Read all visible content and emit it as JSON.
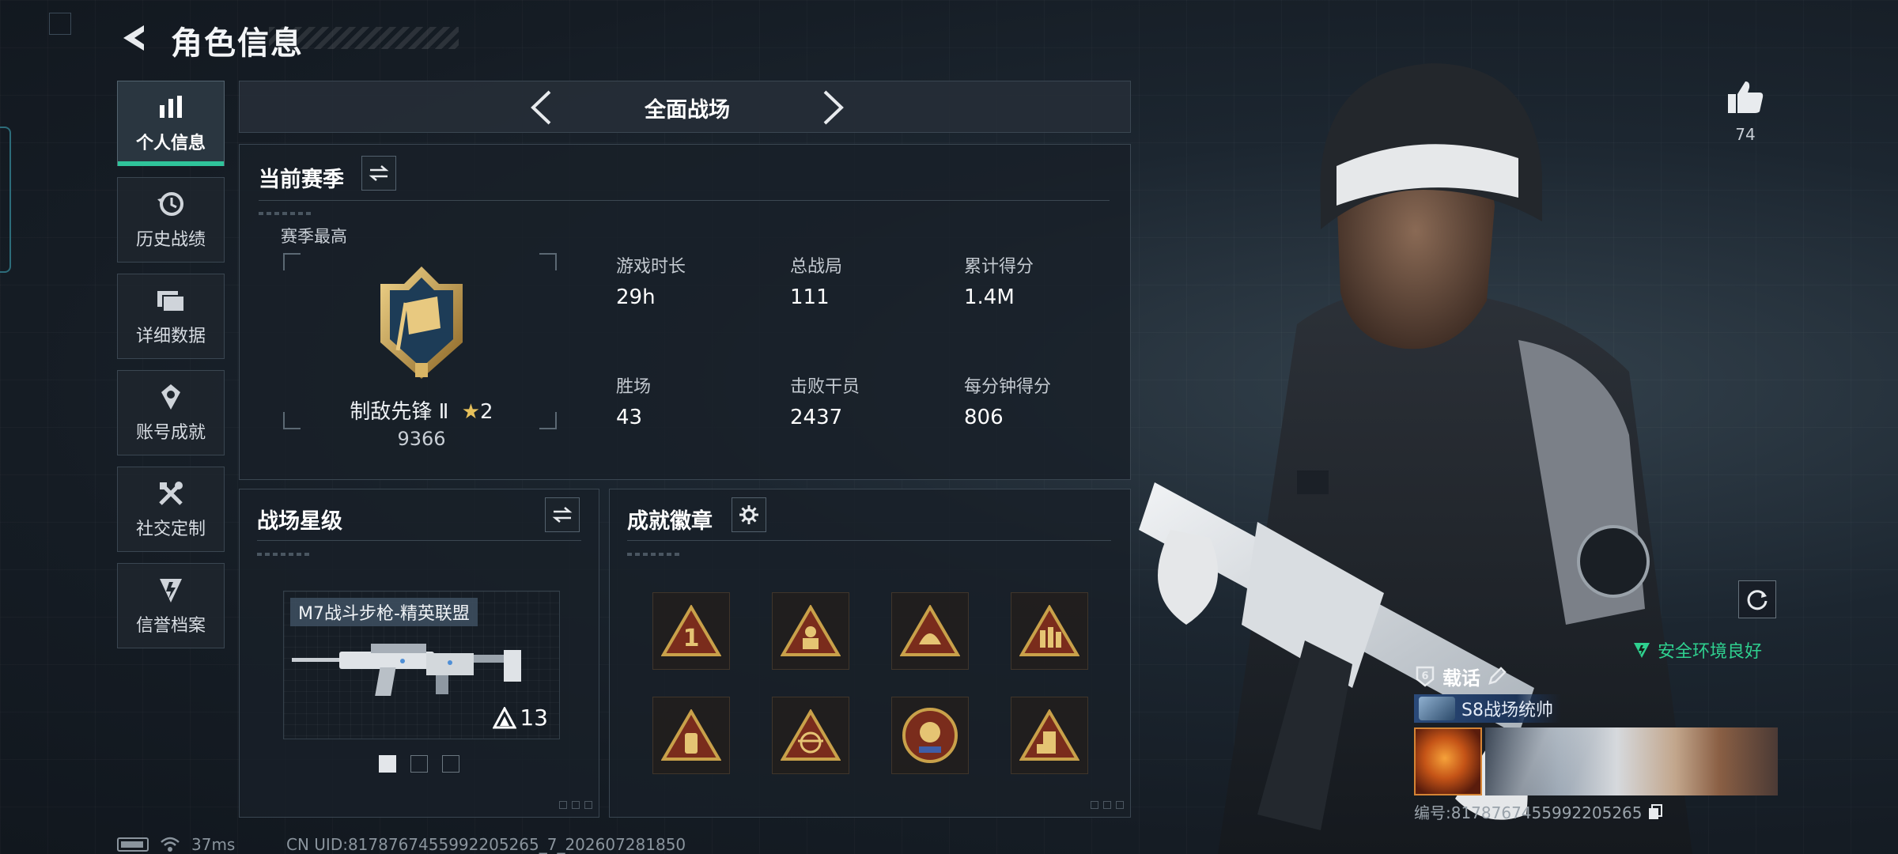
{
  "header": {
    "title": "角色信息"
  },
  "nav": {
    "items": [
      {
        "label": "个人信息",
        "icon": "bar-chart-icon",
        "active": true
      },
      {
        "label": "历史战绩",
        "icon": "history-icon"
      },
      {
        "label": "详细数据",
        "icon": "folder-icon"
      },
      {
        "label": "账号成就",
        "icon": "medal-icon"
      },
      {
        "label": "社交定制",
        "icon": "tools-icon"
      },
      {
        "label": "信誉档案",
        "icon": "shield-icon"
      }
    ]
  },
  "mode": {
    "label": "全面战场"
  },
  "season": {
    "title": "当前赛季",
    "best_label": "赛季最高",
    "rank_name": "制敌先锋 Ⅱ",
    "rank_stars": "2",
    "rank_points": "9366",
    "stats": [
      {
        "label": "游戏时长",
        "value": "29h"
      },
      {
        "label": "总战局",
        "value": "111"
      },
      {
        "label": "累计得分",
        "value": "1.4M"
      },
      {
        "label": "胜场",
        "value": "43"
      },
      {
        "label": "击败干员",
        "value": "2437"
      },
      {
        "label": "每分钟得分",
        "value": "806"
      }
    ]
  },
  "battlefield_star": {
    "title": "战场星级",
    "weapon_name": "M7战斗步枪-精英联盟",
    "weapon_level": "13",
    "page_count": 3,
    "page_active": 1
  },
  "achievements": {
    "title": "成就徽章",
    "badges": [
      "rank-one-badge-icon",
      "soldier-badge-icon",
      "helmet-badge-icon",
      "ammo-badge-icon",
      "grenade-badge-icon",
      "eagle-badge-icon",
      "round-crest-badge-icon",
      "gear-badge-icon"
    ]
  },
  "right": {
    "like_count": "74",
    "safe_env": "安全环境良好",
    "vehicle_label": "载话",
    "player_title": "S8战场统帅",
    "card_id": "编号:8178767455992205265"
  },
  "status": {
    "ping": "37ms",
    "uid": "CN UID:8178767455992205265_7_202607281850"
  },
  "colors": {
    "accent": "#2fc39a",
    "safe": "#2fd08f",
    "gold": "#c9a14a"
  }
}
